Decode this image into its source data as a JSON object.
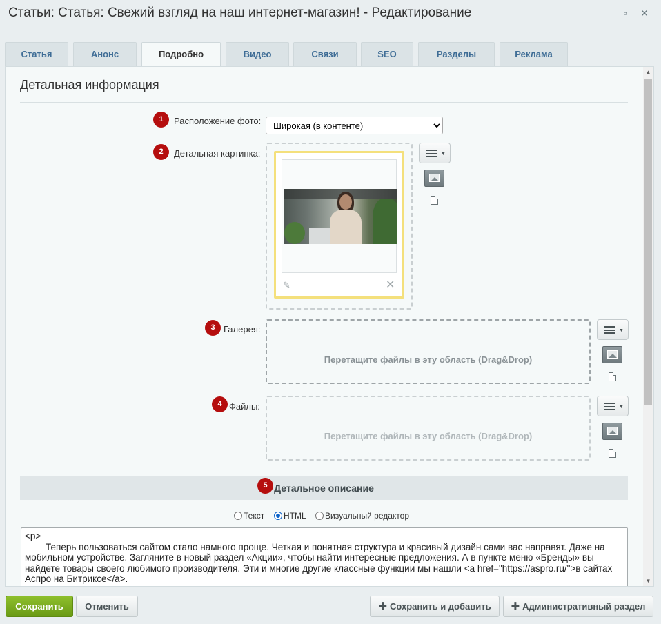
{
  "window": {
    "title": "Статьи: Статья: Свежий взгляд на наш интернет-магазин! - Редактирование"
  },
  "tabs": [
    {
      "label": "Статья"
    },
    {
      "label": "Анонс"
    },
    {
      "label": "Подробно",
      "active": true
    },
    {
      "label": "Видео"
    },
    {
      "label": "Связи"
    },
    {
      "label": "SEO"
    },
    {
      "label": "Разделы"
    },
    {
      "label": "Реклама"
    }
  ],
  "section": {
    "title": "Детальная информация"
  },
  "fields": {
    "photo_position": {
      "badge": "1",
      "label": "Расположение фото:",
      "value": "Широкая (в контенте)"
    },
    "detail_picture": {
      "badge": "2",
      "label": "Детальная картинка:"
    },
    "gallery": {
      "badge": "3",
      "label": "Галерея:",
      "dropzone_text": "Перетащите файлы в эту область (Drag&Drop)"
    },
    "files": {
      "badge": "4",
      "label": "Файлы:",
      "dropzone_text": "Перетащите файлы в эту область (Drag&Drop)"
    }
  },
  "description": {
    "badge": "5",
    "title": "Детальное описание",
    "modes": [
      {
        "label": "Текст",
        "selected": false
      },
      {
        "label": "HTML",
        "selected": true
      },
      {
        "label": "Визуальный редактор",
        "selected": false
      }
    ],
    "content": "<p>\n\tТеперь пользоваться сайтом стало намного проще. Четкая и понятная структура и красивый дизайн сами вас направят. Даже на мобильном устройстве. Загляните в новый раздел «Акции», чтобы найти интересные предложения. А в пункте меню «Бренды» вы найдете товары своего любимого производителя. Эти и многие другие классные функции мы нашли <a href=\"https://aspro.ru/\">в сайтах Аспро на Битриксе</a>.\n</p>"
  },
  "footer": {
    "save": "Сохранить",
    "cancel": "Отменить",
    "save_add": "Сохранить и добавить",
    "admin": "Административный раздел"
  },
  "icons": [
    "maximize-icon",
    "close-icon",
    "menu-icon",
    "image-icon",
    "file-icon",
    "pencil-icon",
    "delete-icon",
    "plus-icon"
  ],
  "colors": {
    "badge": "#b50e0e",
    "primary_button": "#7aab1f",
    "tab_text": "#3f6d96",
    "image_frame": "#f4e07c"
  }
}
